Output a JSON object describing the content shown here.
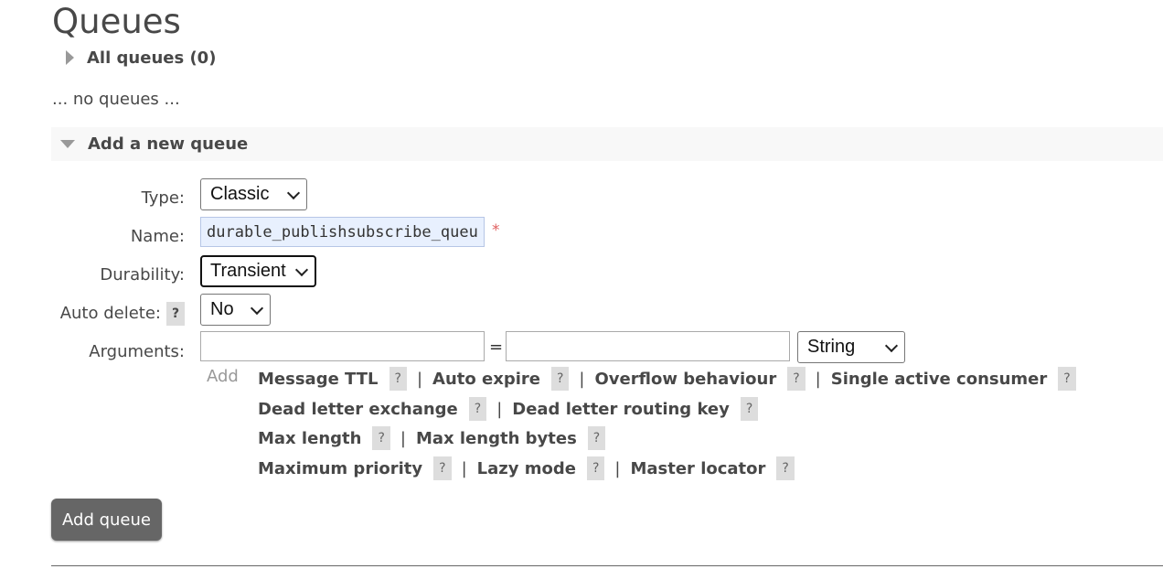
{
  "page_title": "Queues",
  "all_queues": {
    "label": "All queues (0)",
    "expanded": false
  },
  "no_queues_text": "... no queues ...",
  "add_queue_section": {
    "label": "Add a new queue",
    "expanded": true,
    "fields": {
      "type": {
        "label": "Type:",
        "value": "Classic"
      },
      "name": {
        "label": "Name:",
        "value": "durable_publishsubscribe_queue",
        "required_marker": "*"
      },
      "durability": {
        "label": "Durability:",
        "value": "Transient"
      },
      "auto_delete": {
        "label": "Auto delete:",
        "help": "?",
        "value": "No"
      },
      "arguments": {
        "label": "Arguments:",
        "key": "",
        "equals": "=",
        "value": "",
        "type": "String"
      }
    },
    "add_label": "Add",
    "argument_rows": [
      [
        {
          "label": "Message TTL",
          "help": "?"
        },
        {
          "label": "Auto expire",
          "help": "?"
        },
        {
          "label": "Overflow behaviour",
          "help": "?"
        },
        {
          "label": "Single active consumer",
          "help": "?"
        }
      ],
      [
        {
          "label": "Dead letter exchange",
          "help": "?"
        },
        {
          "label": "Dead letter routing key",
          "help": "?"
        }
      ],
      [
        {
          "label": "Max length",
          "help": "?"
        },
        {
          "label": "Max length bytes",
          "help": "?"
        }
      ],
      [
        {
          "label": "Maximum priority",
          "help": "?"
        },
        {
          "label": "Lazy mode",
          "help": "?"
        },
        {
          "label": "Master locator",
          "help": "?"
        }
      ]
    ],
    "separator": "|",
    "submit_label": "Add queue"
  }
}
